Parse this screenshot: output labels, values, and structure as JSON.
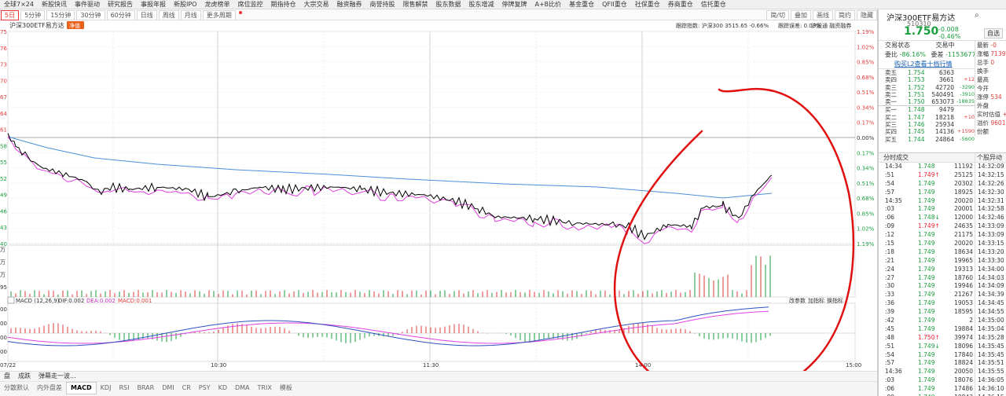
{
  "topnav": [
    "全球7×24",
    "新股快讯",
    "事件驱动",
    "研究报告",
    "事报年报",
    "新股IPO",
    "龙虎榜单",
    "席位监控",
    "期指持仓",
    "大宗交易",
    "融资融券",
    "商誉持股",
    "限售解禁",
    "股东数据",
    "股东增减",
    "停牌复牌",
    "A+B比价",
    "基金重仓",
    "QFII重仓",
    "社保重仓",
    "券商重仓",
    "信托重仓"
  ],
  "periods": [
    "5日",
    "5分钟",
    "15分钟",
    "30分钟",
    "60分钟",
    "日线",
    "周线",
    "月线",
    "更多周期"
  ],
  "toolbar_right": [
    "简/切",
    "叠加",
    "画线",
    "简约",
    "隐藏"
  ],
  "chart": {
    "title": "沪深300ETF易方达",
    "badge": "净值",
    "track_index": "跟踪指数: 沪深300  3515.65  -0.66%",
    "track_error": "跟踪误差: 0.03%",
    "flags": "沪股通  融资融券",
    "left_price_ticks": [
      "75",
      "76",
      "73",
      "70",
      "67",
      "64",
      "61",
      "58",
      "55",
      "52",
      "49",
      "46",
      "43",
      "40"
    ],
    "right_pct_ticks": [
      "1.19%",
      "1.02%",
      "0.85%",
      "0.68%",
      "0.51%",
      "0.34%",
      "0.17%",
      "0.00%",
      "0.17%",
      "0.34%",
      "0.51%",
      "0.68%",
      "0.85%",
      "1.02%",
      "1.19%"
    ],
    "x_labels": [
      "07/22",
      "10:30",
      "11:30",
      "14:00",
      "15:00"
    ],
    "vol_labels": [
      "万",
      "万",
      "万",
      "95"
    ],
    "macd_label": "MACD (12,26,9)",
    "macd_dif": "DIF:0.002",
    "macd_dea": "DEA:0.002",
    "macd_val": "MACD:0.001",
    "macd_right_buttons": [
      "改参数",
      "加指标",
      "换指标"
    ],
    "macd_left_ticks": [
      "00",
      "00",
      "00",
      "00"
    ]
  },
  "bottom_tabs_row1": [
    "盘",
    "成跌",
    "弹幕走一波..."
  ],
  "bottom_tabs_row2": [
    "分散默认",
    "内外盘差",
    "MACD",
    "KDJ",
    "RSI",
    "BRAR",
    "DMI",
    "CR",
    "PSY",
    "KD",
    "DMA",
    "TRIX",
    "模板"
  ],
  "stock": {
    "name": "沪深300ETF易方达",
    "code": "510310",
    "price": "1.750",
    "change": "-0.008",
    "change_pct": "-0.46%",
    "btn": "自选"
  },
  "order_book": {
    "status_label": "交易状态",
    "status_value": "交易中",
    "wb_label": "委比",
    "wb_value": "-86.16%",
    "wc_label": "委差",
    "wc_value": "-1153677",
    "l2_link": "购买L2查看十档行情",
    "asks": [
      {
        "label": "卖五",
        "price": "1.754",
        "vol": "6363",
        "delta": ""
      },
      {
        "label": "卖四",
        "price": "1.753",
        "vol": "3661",
        "delta": "+12"
      },
      {
        "label": "卖三",
        "price": "1.752",
        "vol": "42720",
        "delta": "-3290"
      },
      {
        "label": "卖二",
        "price": "1.751",
        "vol": "540491",
        "delta": "-3910"
      },
      {
        "label": "卖一",
        "price": "1.750",
        "vol": "653073",
        "delta": "-18835"
      }
    ],
    "bids": [
      {
        "label": "买一",
        "price": "1.748",
        "vol": "9479",
        "delta": ""
      },
      {
        "label": "买二",
        "price": "1.747",
        "vol": "18218",
        "delta": "+10"
      },
      {
        "label": "买三",
        "price": "1.746",
        "vol": "25934",
        "delta": ""
      },
      {
        "label": "买四",
        "price": "1.745",
        "vol": "14136",
        "delta": "+1590"
      },
      {
        "label": "买五",
        "price": "1.744",
        "vol": "24864",
        "delta": "-5600"
      }
    ]
  },
  "side_stats": [
    "最新",
    "涨幅",
    "总手",
    "换手",
    "最高",
    "今开",
    "涨停",
    "外盘",
    "实时估值",
    "溢价",
    "份额"
  ],
  "side_stats_vals": [
    "-0",
    "7139",
    "0",
    "",
    "",
    "",
    "534",
    "",
    "+0",
    "9601",
    ""
  ],
  "trades_header": "分时成交",
  "trades": [
    {
      "t": "14:34",
      "p": "1.748",
      "v": "11192",
      "up": false
    },
    {
      "t": ":51",
      "p": "1.749↑",
      "v": "25125",
      "up": true
    },
    {
      "t": ":54",
      "p": "1.749",
      "v": "20302",
      "up": false
    },
    {
      "t": ":57",
      "p": "1.749",
      "v": "18925",
      "up": false
    },
    {
      "t": "14:35",
      "p": "1.749",
      "v": "20020",
      "up": false
    },
    {
      "t": ":03",
      "p": "1.749",
      "v": "20001",
      "up": false
    },
    {
      "t": ":06",
      "p": "1.748↓",
      "v": "12000",
      "up": false
    },
    {
      "t": ":09",
      "p": "1.749↑",
      "v": "24635",
      "up": true
    },
    {
      "t": ":12",
      "p": "1.749",
      "v": "21175",
      "up": false
    },
    {
      "t": ":15",
      "p": "1.749",
      "v": "20020",
      "up": false
    },
    {
      "t": ":18",
      "p": "1.749",
      "v": "18634",
      "up": false
    },
    {
      "t": ":21",
      "p": "1.749",
      "v": "19965",
      "up": false
    },
    {
      "t": ":24",
      "p": "1.749",
      "v": "19313",
      "up": false
    },
    {
      "t": ":27",
      "p": "1.749",
      "v": "18760",
      "up": false
    },
    {
      "t": ":30",
      "p": "1.749",
      "v": "19946",
      "up": false
    },
    {
      "t": ":33",
      "p": "1.749",
      "v": "21267",
      "up": false
    },
    {
      "t": ":36",
      "p": "1.749",
      "v": "19053",
      "up": false
    },
    {
      "t": ":39",
      "p": "1.749",
      "v": "18595",
      "up": false
    },
    {
      "t": ":42",
      "p": "1.749",
      "v": "2",
      "up": false
    },
    {
      "t": ":45",
      "p": "1.749",
      "v": "19884",
      "up": false
    },
    {
      "t": ":48",
      "p": "1.750↑",
      "v": "39974",
      "up": true
    },
    {
      "t": ":51",
      "p": "1.749↓",
      "v": "18096",
      "up": false
    },
    {
      "t": ":54",
      "p": "1.749",
      "v": "17840",
      "up": false
    },
    {
      "t": ":57",
      "p": "1.749",
      "v": "18824",
      "up": false
    },
    {
      "t": "14:36",
      "p": "1.749",
      "v": "20050",
      "up": false
    },
    {
      "t": ":03",
      "p": "1.749",
      "v": "18076",
      "up": false
    },
    {
      "t": ":06",
      "p": "1.749",
      "v": "17486",
      "up": false
    },
    {
      "t": ":09",
      "p": "1.749",
      "v": "19842",
      "up": false
    }
  ],
  "times2_header": "个股异动",
  "times2": [
    "14:32:09",
    "14:32:15",
    "14:32:26",
    "14:32:30",
    "14:32:31",
    "14:32:58",
    "14:32:46",
    "14:33:09",
    "14:33:09",
    "14:33:15",
    "14:33:20",
    "14:33:30",
    "14:34:00",
    "14:34:03",
    "14:34:09",
    "14:34:39",
    "14:34:45",
    "14:34:55",
    "14:35:00",
    "14:35:04",
    "14:35:28",
    "14:35:45",
    "14:35:45",
    "14:35:51",
    "14:35:55",
    "14:36:05",
    "14:36:10",
    "14:36:15"
  ],
  "colors": {
    "price": "#000000",
    "avg": "#e040e0",
    "ma": "#4a90d9",
    "up": "#e23b3b",
    "down": "#1a9e3f",
    "annotation": "#e01010"
  }
}
